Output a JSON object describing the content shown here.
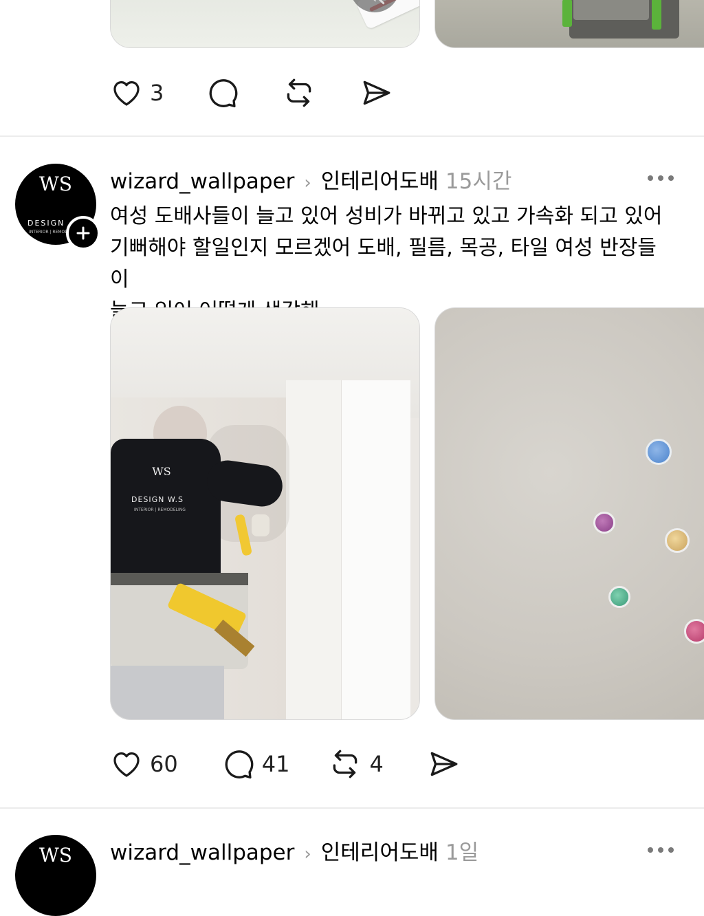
{
  "posts": [
    {
      "stats": {
        "likes": "3"
      }
    },
    {
      "username": "wizard_wallpaper",
      "topic": "인테리어도배",
      "time": "15시간",
      "text_lines": [
        "여성 도배사들이 늘고 있어 성비가 바뀌고 있고 가속화 되고 있어",
        "기뻐해야 할일인지 모르겠어 도배, 필름, 목공, 타일 여성 반장들이",
        "늘고 있어 어떻게 생각해"
      ],
      "avatar": {
        "brand_top": "WS",
        "brand_text": "DESIGN",
        "brand_sub": "INTERIOR | REMODELING"
      },
      "photo1": {
        "shirt_logo": "WS",
        "shirt_text": "DESIGN W.S",
        "shirt_sub": "INTERIOR | REMODELING"
      },
      "stats": {
        "likes": "60",
        "comments": "41",
        "reposts": "4"
      }
    },
    {
      "username": "wizard_wallpaper",
      "topic": "인테리어도배",
      "time": "1일"
    }
  ],
  "icons": {
    "like": "heart-icon",
    "comment": "comment-icon",
    "repost": "repost-icon",
    "share": "send-icon",
    "more": "more-dots-icon",
    "follow": "plus-icon",
    "mute": "mute-icon",
    "chevron": "chevron-right-icon"
  }
}
